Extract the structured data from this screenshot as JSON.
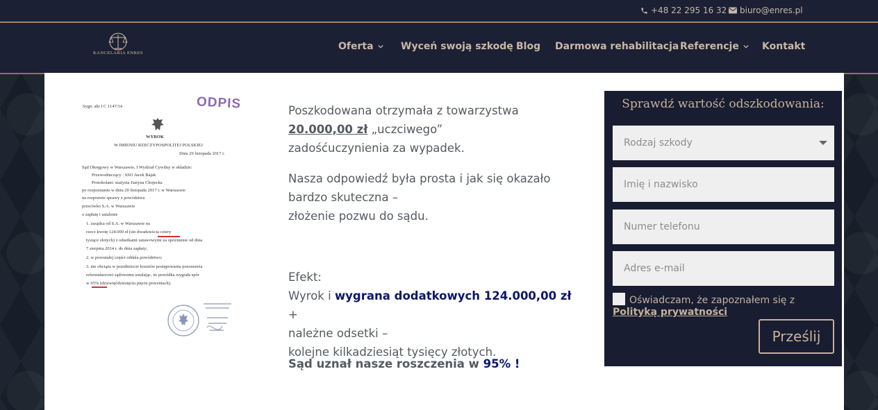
{
  "topbar": {
    "phone": "+48 22 295 16 32",
    "email": "biuro@enres.pl",
    "phone_icon": "phone-icon",
    "email_icon": "envelope-icon"
  },
  "logo": {
    "text": "KANCELARIA ENRES"
  },
  "nav": {
    "items": [
      {
        "label": "Oferta",
        "dropdown": true
      },
      {
        "label": "Wyceń swoją szkodę",
        "dropdown": false
      },
      {
        "label": "Blog",
        "dropdown": false
      },
      {
        "label": "Darmowa rehabilitacja",
        "dropdown": false
      },
      {
        "label": "Referencje",
        "dropdown": true
      },
      {
        "label": "Kontakt",
        "dropdown": false
      }
    ]
  },
  "document": {
    "stamp": "ODPIS",
    "sygn": "Sygn. akt I C 1147/14",
    "wyrok": "WYROK",
    "imie": "W IMIENIU RZECZYPOSPOLITEJ POLSKIEJ",
    "date": "Dnia 29 listopada 2017 r.",
    "lines": [
      "Sąd Okręgowy w Warszawie, I Wydział Cywilny w składzie:",
      "Przewodniczący : SSO Jacek Bajak",
      "Protokolant:         stażysta Justyna Chojecka",
      "po rozpoznaniu w dniu 20 listopada 2017 r. w Warszawie",
      "na rozprawie sprawy z powództwa",
      "przeciwko                                  S.A. w Warszawie",
      "o zapłatę i ustalenie",
      "1.  zasądza od                         S.A. w Warszawie na",
      "     rzecz                    kwotę 124.000 zł (sto dwadzieścia cztery",
      "     tysiące złotych) z odsetkami ustawowymi za opóźnienie od dnia",
      "     7 sierpnia 2014 r. do dnia zapłaty;",
      "2.  w pozostałej części oddala powództwo;",
      "3.  nie obciąża w przedmiocie kosztów postępowania pozostawia",
      "     referendarzowi sądowemu ustalając, że powódka wygrała spór",
      "     w 95% (dziewięćdziesięciu pięciu procentach)."
    ]
  },
  "content": {
    "p1_a": "Poszkodowana otrzymała z towarzystwa",
    "p1_amount": "20.000,00 zł",
    "p1_b": " „uczciwego”",
    "p1_c": "zadośćuczynienia za wypadek.",
    "p2_a": "Nasza odpowiedź była prosta i jak się okazało",
    "p2_b": "bardzo skuteczna –",
    "p2_c": "złożenie pozwu do sądu.",
    "efekt": "Efekt:",
    "wyrok_a": "Wyrok i ",
    "wyrok_bold": "wygrana dodatkowych 124.000,00 zł",
    "wyrok_b": " +",
    "wyrok_c": "należne odsetki –",
    "wyrok_d": "kolejne kilkadziesiąt tysięcy złotych.",
    "final_a": "Sąd uznał nasze roszczenia w ",
    "final_b": "95% !"
  },
  "form": {
    "title": "Sprawdź wartość odszkodowania:",
    "select_placeholder": "Rodzaj szkody",
    "name_placeholder": "Imię i nazwisko",
    "phone_placeholder": "Numer telefonu",
    "email_placeholder": "Adres e-mail",
    "consent_text": "Oświadczam, że zapoznałem się z ",
    "consent_link": "Polityką prywatności",
    "submit": "Prześlij"
  }
}
